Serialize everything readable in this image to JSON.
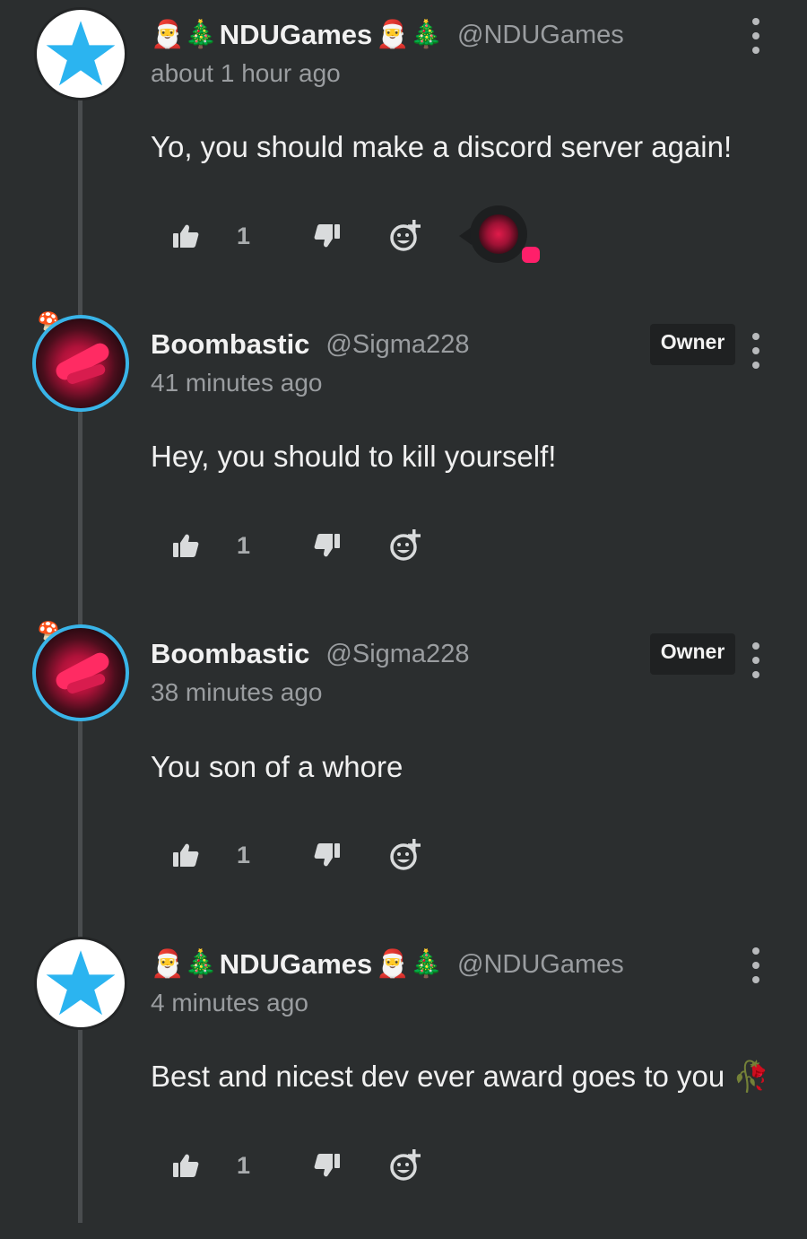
{
  "colors": {
    "background": "#2b2e2f",
    "owner_badge_bg": "#1f2122",
    "avatar_ring": "#39b4e8",
    "star": "#2bb4f0",
    "icon": "#d9dbdc"
  },
  "comments": [
    {
      "author": "NDUGames",
      "emoji_prefix": "🎅🎄",
      "emoji_suffix": "🎅🎄",
      "handle": "@NDUGames",
      "time": "about 1 hour ago",
      "text": "Yo, you should make a discord server again!",
      "likes": "1",
      "avatar": "star-avatar",
      "has_reaction": true
    },
    {
      "author": "Boombastic",
      "handle": "@Sigma228",
      "badge": "Owner",
      "time": "41 minutes ago",
      "text": "Hey, you should to kill yourself!",
      "likes": "1",
      "avatar": "red-avatar"
    },
    {
      "author": "Boombastic",
      "handle": "@Sigma228",
      "badge": "Owner",
      "time": "38 minutes ago",
      "text": "You son of a whore",
      "likes": "1",
      "avatar": "red-avatar"
    },
    {
      "author": "NDUGames",
      "emoji_prefix": "🎅🎄",
      "emoji_suffix": "🎅🎄",
      "handle": "@NDUGames",
      "time": "4 minutes ago",
      "text": "Best and nicest dev ever award goes to you 🥀",
      "likes": "1",
      "avatar": "star-avatar"
    }
  ]
}
